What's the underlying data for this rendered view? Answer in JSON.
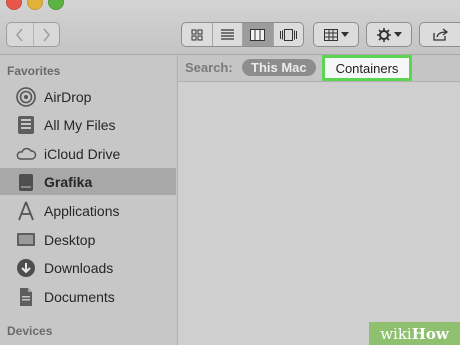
{
  "toolbar": {
    "nav": {
      "back": "chevron-left-icon",
      "forward": "chevron-right-icon"
    },
    "views": [
      "icon-view",
      "list-view",
      "column-view",
      "cover-flow-view"
    ],
    "active_view": "column-view",
    "arrange": "arrange-grid-icon",
    "action": "gear-icon",
    "share": "share-icon"
  },
  "sidebar": {
    "favorites_title": "Favorites",
    "items": [
      {
        "label": "AirDrop",
        "icon": "airdrop-icon"
      },
      {
        "label": "All My Files",
        "icon": "all-files-icon"
      },
      {
        "label": "iCloud Drive",
        "icon": "cloud-icon"
      },
      {
        "label": "Grafika",
        "icon": "drive-icon",
        "selected": true
      },
      {
        "label": "Applications",
        "icon": "applications-icon"
      },
      {
        "label": "Desktop",
        "icon": "desktop-icon"
      },
      {
        "label": "Downloads",
        "icon": "downloads-icon"
      },
      {
        "label": "Documents",
        "icon": "documents-icon"
      }
    ],
    "devices_title": "Devices"
  },
  "searchbar": {
    "label": "Search:",
    "scope_this_mac": "This Mac",
    "scope_containers": "Containers"
  },
  "watermark": {
    "part1": "wiki",
    "part2": "How"
  },
  "colors": {
    "highlight": "#5bd552",
    "selected_row": "#a8a8a8"
  }
}
